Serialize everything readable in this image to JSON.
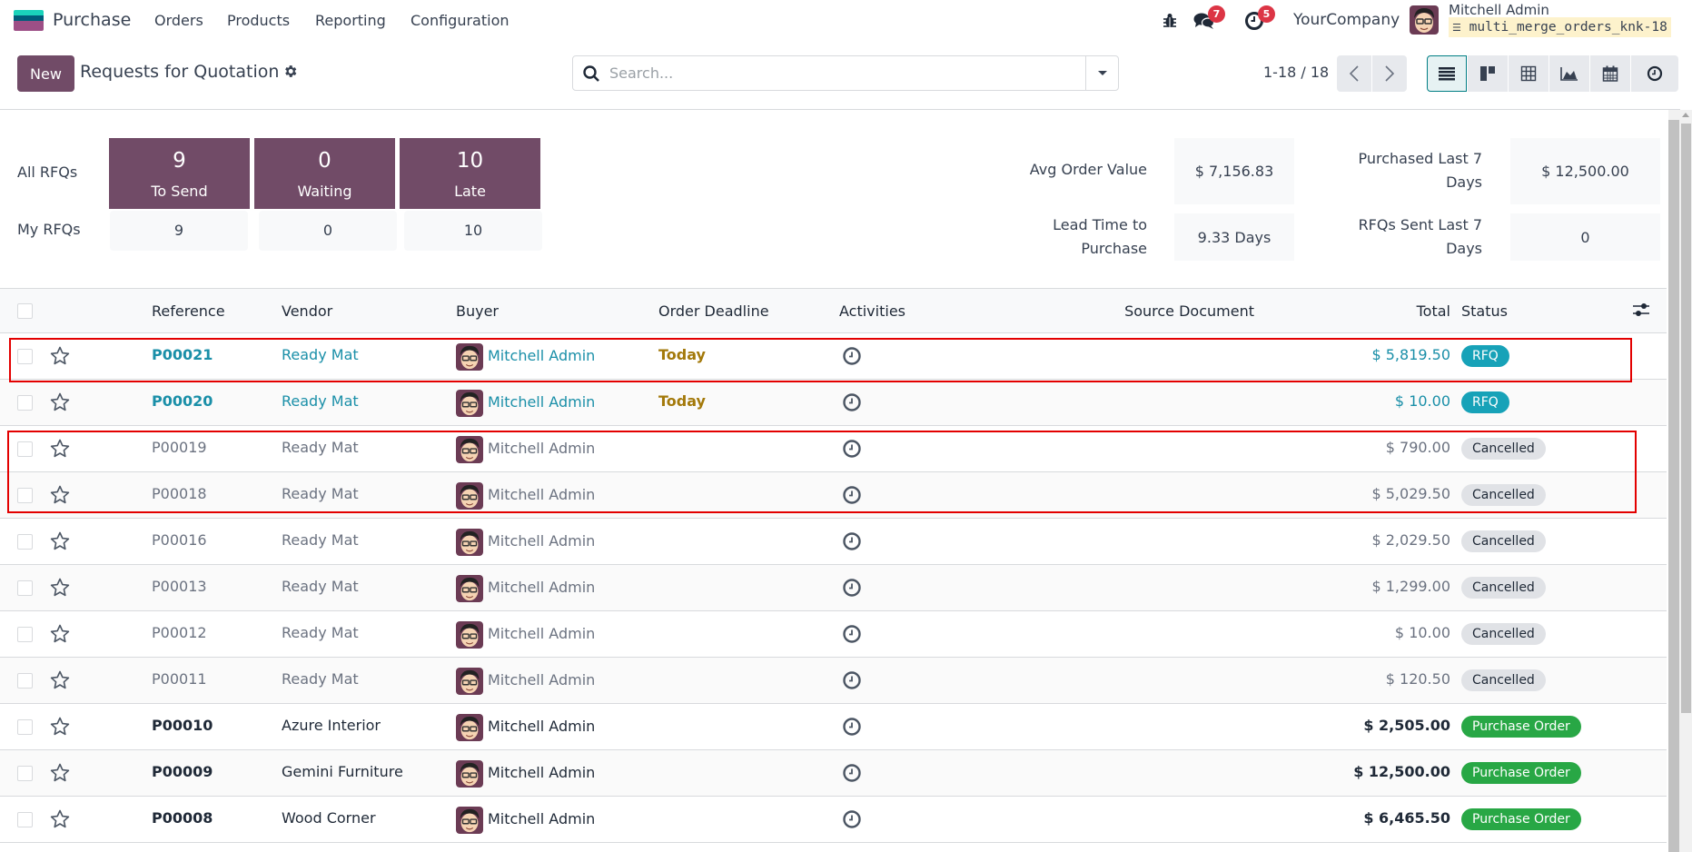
{
  "navbar": {
    "app_name": "Purchase",
    "menus": [
      "Orders",
      "Products",
      "Reporting",
      "Configuration"
    ],
    "icons": [
      "bug-icon",
      "chat-icon",
      "activity-clock-icon"
    ],
    "messages_count": "7",
    "activities_count": "5",
    "company": "YourCompany",
    "user_name": "Mitchell Admin",
    "database": "multi_merge_orders_knk-18"
  },
  "control_panel": {
    "new_label": "New",
    "title": "Requests for Quotation",
    "search_placeholder": "Search...",
    "pager": "1-18 / 18",
    "views": [
      "list",
      "kanban",
      "pivot",
      "graph",
      "calendar",
      "activity"
    ],
    "active_view": "list"
  },
  "dashboard": {
    "row_labels": {
      "all": "All RFQs",
      "mine": "My RFQs"
    },
    "tiles": [
      {
        "label": "To Send",
        "all": "9",
        "mine": "9"
      },
      {
        "label": "Waiting",
        "all": "0",
        "mine": "0"
      },
      {
        "label": "Late",
        "all": "10",
        "mine": "10"
      }
    ],
    "metrics": [
      {
        "label_line1": "Avg Order Value",
        "label_line2": "",
        "value": "$ 7,156.83"
      },
      {
        "label_line1": "Purchased Last 7",
        "label_line2": "Days",
        "value": "$ 12,500.00"
      },
      {
        "label_line1": "Lead Time to",
        "label_line2": "Purchase",
        "value": "9.33 Days"
      },
      {
        "label_line1": "RFQs Sent Last 7",
        "label_line2": "Days",
        "value": "0"
      }
    ]
  },
  "table": {
    "columns": {
      "reference": "Reference",
      "vendor": "Vendor",
      "buyer": "Buyer",
      "order_deadline": "Order Deadline",
      "activities": "Activities",
      "source_document": "Source Document",
      "total": "Total",
      "status": "Status"
    },
    "rows": [
      {
        "reference": "P00021",
        "vendor": "Ready Mat",
        "buyer": "Mitchell Admin",
        "deadline": "Today",
        "source": "",
        "total": "$ 5,819.50",
        "status": "RFQ",
        "state": "rfq"
      },
      {
        "reference": "P00020",
        "vendor": "Ready Mat",
        "buyer": "Mitchell Admin",
        "deadline": "Today",
        "source": "",
        "total": "$ 10.00",
        "status": "RFQ",
        "state": "rfq"
      },
      {
        "reference": "P00019",
        "vendor": "Ready Mat",
        "buyer": "Mitchell Admin",
        "deadline": "",
        "source": "",
        "total": "$ 790.00",
        "status": "Cancelled",
        "state": "cancel"
      },
      {
        "reference": "P00018",
        "vendor": "Ready Mat",
        "buyer": "Mitchell Admin",
        "deadline": "",
        "source": "",
        "total": "$ 5,029.50",
        "status": "Cancelled",
        "state": "cancel"
      },
      {
        "reference": "P00016",
        "vendor": "Ready Mat",
        "buyer": "Mitchell Admin",
        "deadline": "",
        "source": "",
        "total": "$ 2,029.50",
        "status": "Cancelled",
        "state": "cancel"
      },
      {
        "reference": "P00013",
        "vendor": "Ready Mat",
        "buyer": "Mitchell Admin",
        "deadline": "",
        "source": "",
        "total": "$ 1,299.00",
        "status": "Cancelled",
        "state": "cancel"
      },
      {
        "reference": "P00012",
        "vendor": "Ready Mat",
        "buyer": "Mitchell Admin",
        "deadline": "",
        "source": "",
        "total": "$ 10.00",
        "status": "Cancelled",
        "state": "cancel"
      },
      {
        "reference": "P00011",
        "vendor": "Ready Mat",
        "buyer": "Mitchell Admin",
        "deadline": "",
        "source": "",
        "total": "$ 120.50",
        "status": "Cancelled",
        "state": "cancel"
      },
      {
        "reference": "P00010",
        "vendor": "Azure Interior",
        "buyer": "Mitchell Admin",
        "deadline": "",
        "source": "",
        "total": "$ 2,505.00",
        "status": "Purchase Order",
        "state": "po"
      },
      {
        "reference": "P00009",
        "vendor": "Gemini Furniture",
        "buyer": "Mitchell Admin",
        "deadline": "",
        "source": "",
        "total": "$ 12,500.00",
        "status": "Purchase Order",
        "state": "po"
      },
      {
        "reference": "P00008",
        "vendor": "Wood Corner",
        "buyer": "Mitchell Admin",
        "deadline": "",
        "source": "",
        "total": "$ 6,465.50",
        "status": "Purchase Order",
        "state": "po"
      }
    ]
  },
  "colors": {
    "brand": "#714b67",
    "link": "#1a8fa8",
    "rfq_badge": "#17a2b8",
    "cancel_badge": "#e0e2e6",
    "po_badge": "#28a745",
    "deadline_warning": "#a3790a",
    "annotation": "#e30000"
  }
}
